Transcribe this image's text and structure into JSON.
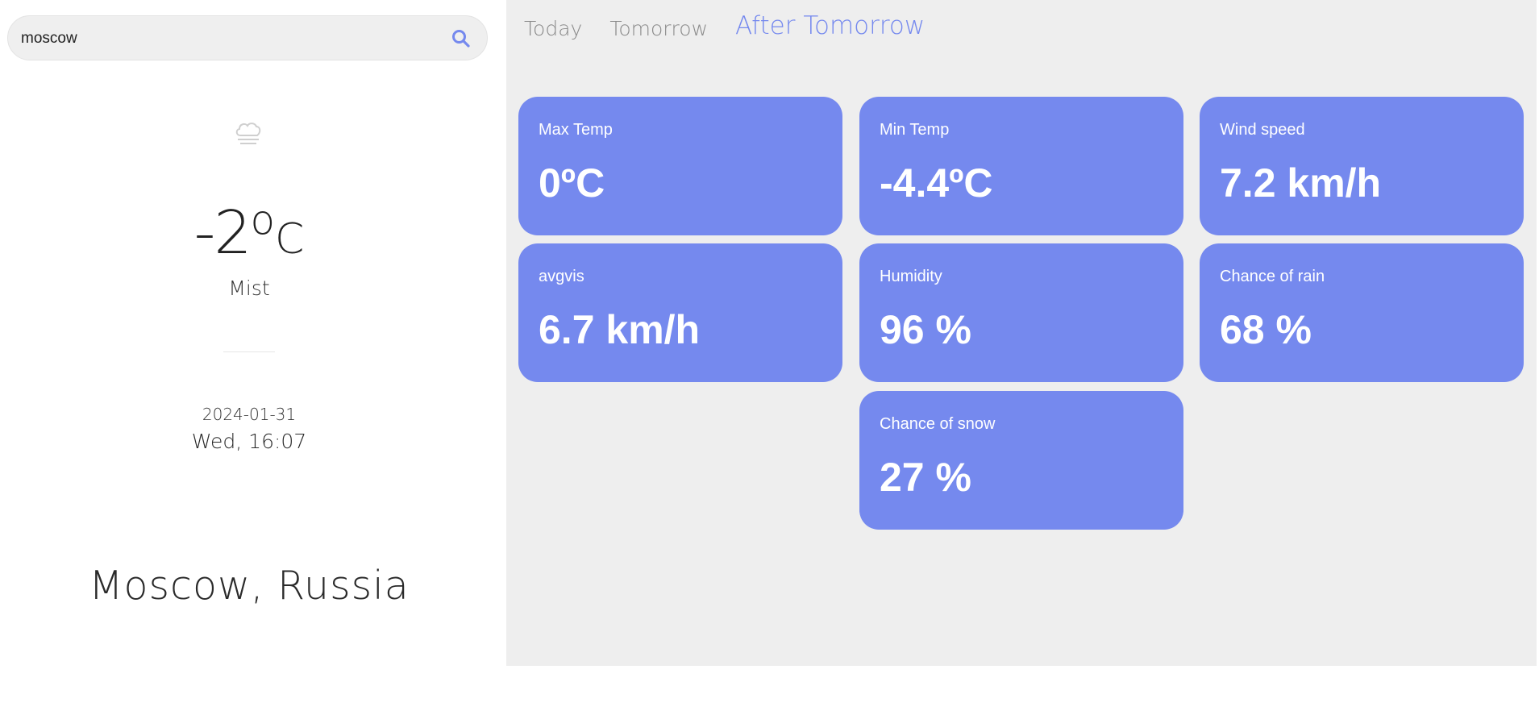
{
  "search": {
    "value": "moscow",
    "icon": "search-icon"
  },
  "current": {
    "icon": "cloud-mist-icon",
    "temperature": "-2",
    "degree_symbol": "o",
    "unit": "C",
    "condition": "Mist",
    "date": "2024-01-31",
    "datetime": "Wed, 16:07",
    "location": "Moscow, Russia"
  },
  "tabs": [
    {
      "label": "Today",
      "active": false
    },
    {
      "label": "Tomorrow",
      "active": false
    },
    {
      "label": "After Tomorrow",
      "active": true
    }
  ],
  "cards": {
    "max_temp": {
      "label": "Max Temp",
      "value": "0ºC"
    },
    "min_temp": {
      "label": "Min Temp",
      "value": "-4.4ºC"
    },
    "wind_speed": {
      "label": "Wind speed",
      "value": "7.2 km/h"
    },
    "avgvis": {
      "label": "avgvis",
      "value": "6.7 km/h"
    },
    "humidity": {
      "label": "Humidity",
      "value": "96 %"
    },
    "chance_of_rain": {
      "label": "Chance of rain",
      "value": "68 %"
    },
    "chance_of_snow": {
      "label": "Chance of snow",
      "value": "27 %"
    }
  },
  "colors": {
    "accent": "#7589ee",
    "panel_background": "#eeeeee",
    "tab_inactive": "#8a8a8a"
  }
}
